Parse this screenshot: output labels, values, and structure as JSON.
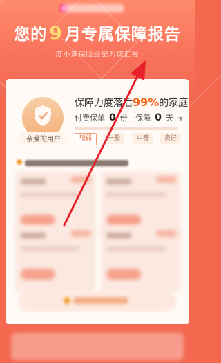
{
  "header": {
    "title_prefix": "您的",
    "month": "9",
    "title_suffix": "月专属保障报告",
    "subtitle": "- 度小满保险经纪为您汇报 -"
  },
  "profile": {
    "nickname": "亲爱的用户",
    "headline_prefix": "保障力度落后",
    "headline_pct": "99%",
    "headline_suffix": "的家庭",
    "policy_label": "付费保单",
    "policy_count": "0",
    "policy_unit": "份",
    "guarantee_label": "保障",
    "guarantee_days": "0",
    "guarantee_unit": "天",
    "progress_fraction": 0.0,
    "levels": [
      "较弱",
      "一般",
      "中等",
      "良好"
    ],
    "active_level": "较弱"
  },
  "colors": {
    "accent": "#f56a1e",
    "hero": "#f8715a",
    "annotation_arrow": "#e8202a"
  }
}
